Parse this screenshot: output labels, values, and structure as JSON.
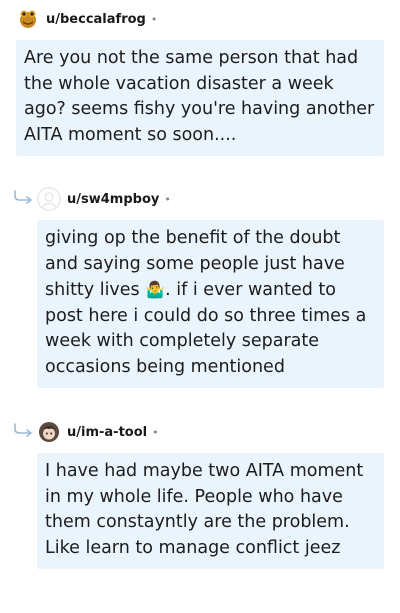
{
  "comments": [
    {
      "username": "u/beccalafrog",
      "separator": "•",
      "text": "Are you not the same person that had the whole vacation disaster a week ago? seems fishy you're having another AITA moment so soon...."
    },
    {
      "username": "u/sw4mpboy",
      "separator": "•",
      "text_before_emoji": "giving op the benefit of the doubt and saying some people just have shitty lives ",
      "emoji": "🤷‍♂️",
      "text_after_emoji": ". if i ever wanted to post here i could do so three times a week with completely separate occasions being mentioned"
    },
    {
      "username": "u/im-a-tool",
      "separator": "•",
      "text": "I have had maybe two AITA moment in my whole life. People who have them constayntly are the problem. Like learn to manage conflict jeez"
    }
  ],
  "colors": {
    "bubble_bg": "#eaf4fd",
    "reply_arrow": "#9bb8d6"
  },
  "icons": [
    "frog-avatar-icon",
    "reply-arrow-icon",
    "default-avatar-icon",
    "character-avatar-icon",
    "shrug-emoji"
  ]
}
